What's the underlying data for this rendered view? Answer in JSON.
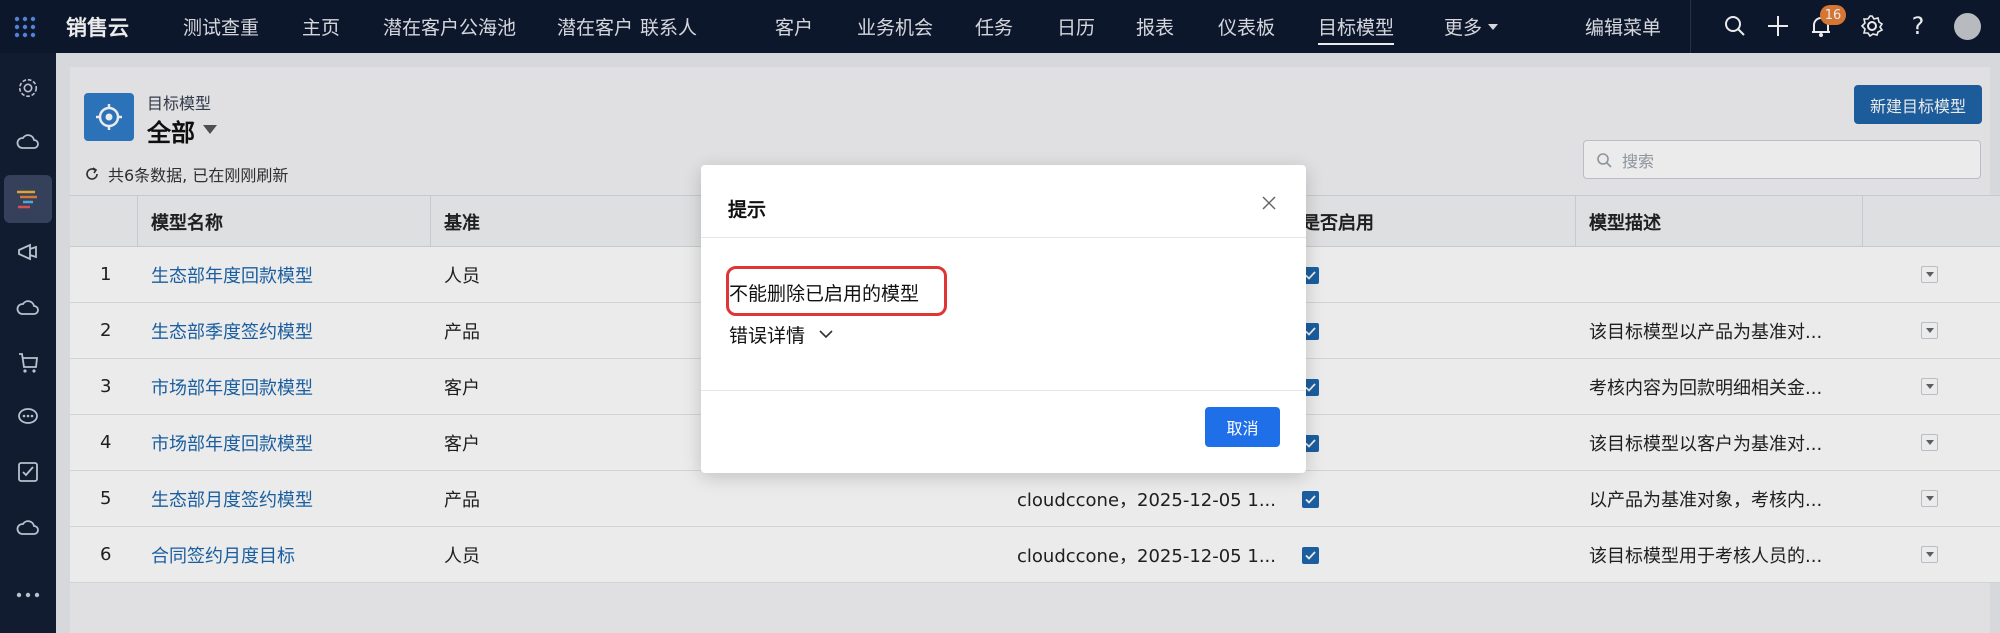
{
  "app": {
    "name": "销售云"
  },
  "nav": {
    "items": [
      {
        "label": "测试查重"
      },
      {
        "label": "主页"
      },
      {
        "label": "潜在客户公海池"
      },
      {
        "label": "潜在客户"
      },
      {
        "label": "联系人"
      },
      {
        "label": "客户"
      },
      {
        "label": "业务机会"
      },
      {
        "label": "任务"
      },
      {
        "label": "日历"
      },
      {
        "label": "报表"
      },
      {
        "label": "仪表板"
      },
      {
        "label": "目标模型",
        "active": true
      },
      {
        "label": "更多"
      },
      {
        "label": "编辑菜单"
      }
    ],
    "notification_count": "16"
  },
  "header": {
    "object_label": "目标模型",
    "view_name": "全部",
    "status": "共6条数据, 已在刚刚刷新",
    "new_button": "新建目标模型",
    "search_placeholder": "搜索"
  },
  "table": {
    "columns": [
      "模型名称",
      "基准",
      "是否启用",
      "模型描述"
    ],
    "rows": [
      {
        "num": "1",
        "name": "生态部年度回款模型",
        "base": "人员",
        "modified": "",
        "enabled": true,
        "desc": ""
      },
      {
        "num": "2",
        "name": "生态部季度签约模型",
        "base": "产品",
        "modified": "",
        "enabled": true,
        "desc": "该目标模型以产品为基准对..."
      },
      {
        "num": "3",
        "name": "市场部年度回款模型",
        "base": "客户",
        "modified": "",
        "enabled": true,
        "desc": "考核内容为回款明细相关金..."
      },
      {
        "num": "4",
        "name": "市场部年度回款模型",
        "base": "客户",
        "modified": "",
        "enabled": true,
        "desc": "该目标模型以客户为基准对..."
      },
      {
        "num": "5",
        "name": "生态部月度签约模型",
        "base": "产品",
        "modified": "cloudccone，2025-12-05 1...",
        "enabled": true,
        "desc": "以产品为基准对象，考核内..."
      },
      {
        "num": "6",
        "name": "合同签约月度目标",
        "base": "人员",
        "modified": "cloudccone，2025-12-05 1...",
        "enabled": true,
        "desc": "该目标模型用于考核人员的..."
      }
    ]
  },
  "modal": {
    "title": "提示",
    "message": "不能删除已启用的模型",
    "details_label": "错误详情",
    "cancel_label": "取消"
  },
  "colors": {
    "topbar": "#0f1a30",
    "link": "#1d67ad",
    "primary_button": "#1f6fe8",
    "highlight": "#e03535",
    "badge": "#e8803a"
  }
}
